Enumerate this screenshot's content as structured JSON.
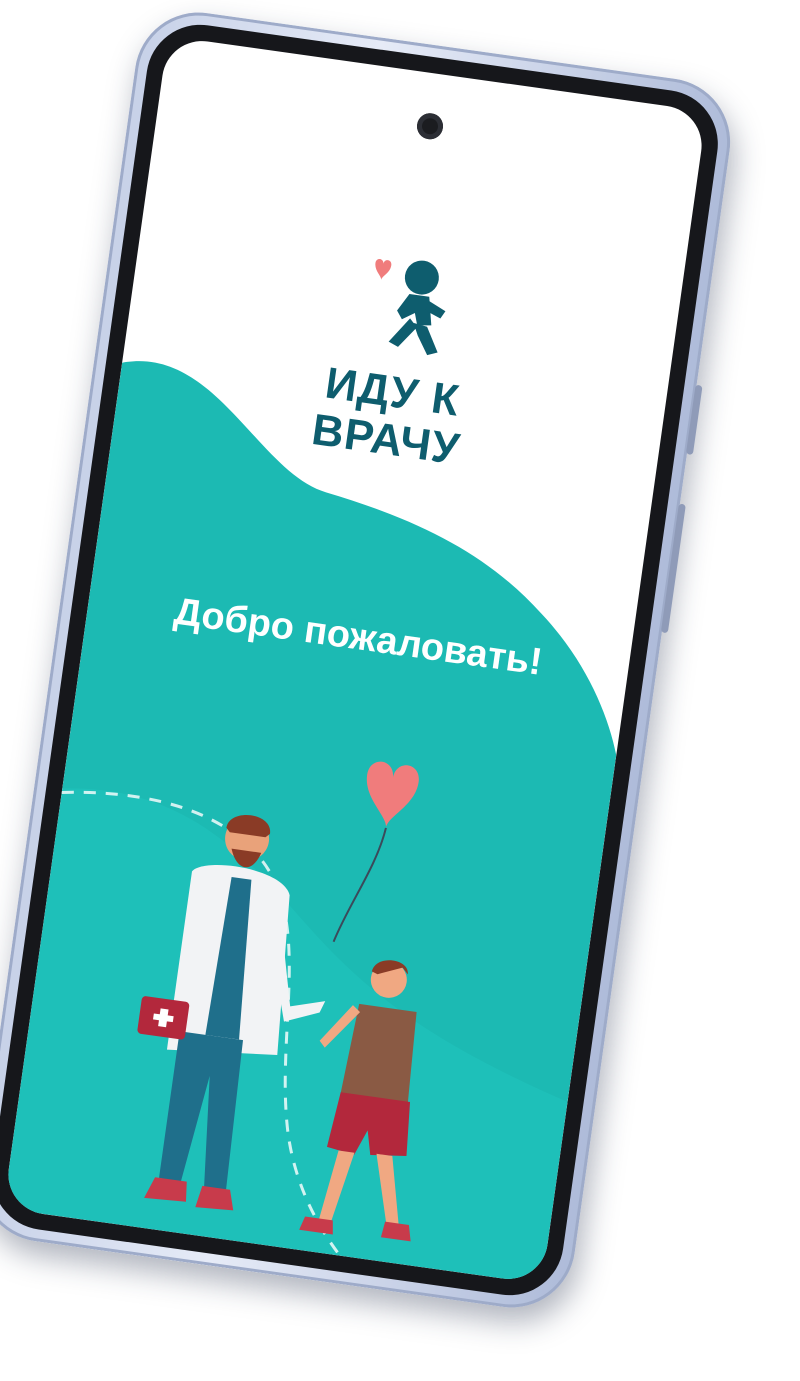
{
  "app": {
    "logo_line1": "ИДУ К",
    "logo_line2": "ВРАЧУ",
    "welcome_text": "Добро пожаловать!"
  },
  "icons": {
    "logo": "running-child-heart-icon",
    "illustration": "doctor-and-child-illustration",
    "camera": "front-camera-icon"
  },
  "colors": {
    "teal_primary": "#1cbab3",
    "teal_dark": "#0e5d6e",
    "heart": "#f07c7c",
    "background": "#ffffff"
  }
}
